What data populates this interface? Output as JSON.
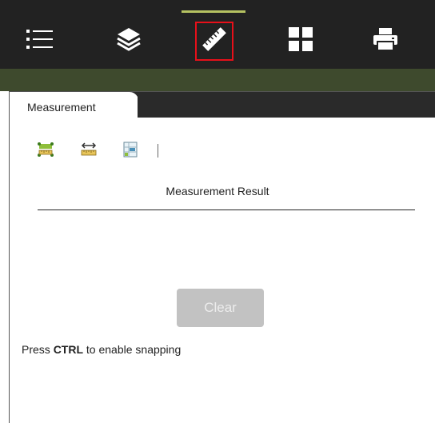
{
  "toolbar": {
    "tools": [
      {
        "icon": "list-icon",
        "label": "List"
      },
      {
        "icon": "layers-icon",
        "label": "Layers"
      },
      {
        "icon": "ruler-icon",
        "label": "Measurement",
        "active": true
      },
      {
        "icon": "grid-icon",
        "label": "Basemap"
      },
      {
        "icon": "printer-icon",
        "label": "Print"
      }
    ],
    "active_color": "#b5c261",
    "highlight_color": "#e8101a"
  },
  "panel": {
    "tab_label": "Measurement",
    "tools": [
      {
        "icon": "area-measure-icon"
      },
      {
        "icon": "distance-measure-icon"
      },
      {
        "icon": "location-measure-icon"
      }
    ],
    "result_title": "Measurement Result",
    "clear_label": "Clear",
    "snap_prefix": "Press ",
    "snap_key": "CTRL",
    "snap_suffix": " to enable snapping"
  }
}
